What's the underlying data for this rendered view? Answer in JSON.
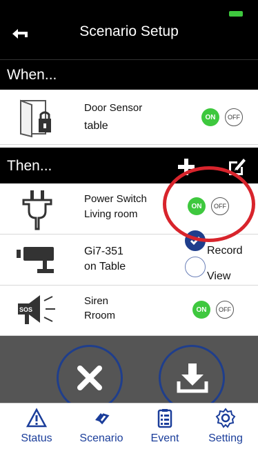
{
  "header": {
    "title": "Scenario Setup"
  },
  "when": {
    "label": "When...",
    "items": [
      {
        "name": "Door Sensor",
        "location": "table",
        "toggle_on": "ON",
        "toggle_off": "OFF"
      }
    ]
  },
  "then": {
    "label": "Then...",
    "items": [
      {
        "name": "Power Switch",
        "location": "Living room",
        "toggle_on": "ON",
        "toggle_off": "OFF"
      },
      {
        "name": "Gi7-351",
        "location": "on Table",
        "option_record": "Record",
        "option_view": "View",
        "selected": "Record"
      },
      {
        "name": "Siren",
        "location": "Rroom",
        "toggle_on": "ON",
        "toggle_off": "OFF"
      }
    ]
  },
  "tabs": [
    {
      "label": "Status",
      "icon": "warning-icon"
    },
    {
      "label": "Scenario",
      "icon": "scenario-icon"
    },
    {
      "label": "Event",
      "icon": "event-list-icon"
    },
    {
      "label": "Setting",
      "icon": "gear-icon"
    }
  ],
  "colors": {
    "accent": "#1a3d9a",
    "on_green": "#3ec83e",
    "highlight_red": "#d8242c",
    "header_bg": "#000000",
    "footer_bg": "#555555"
  }
}
